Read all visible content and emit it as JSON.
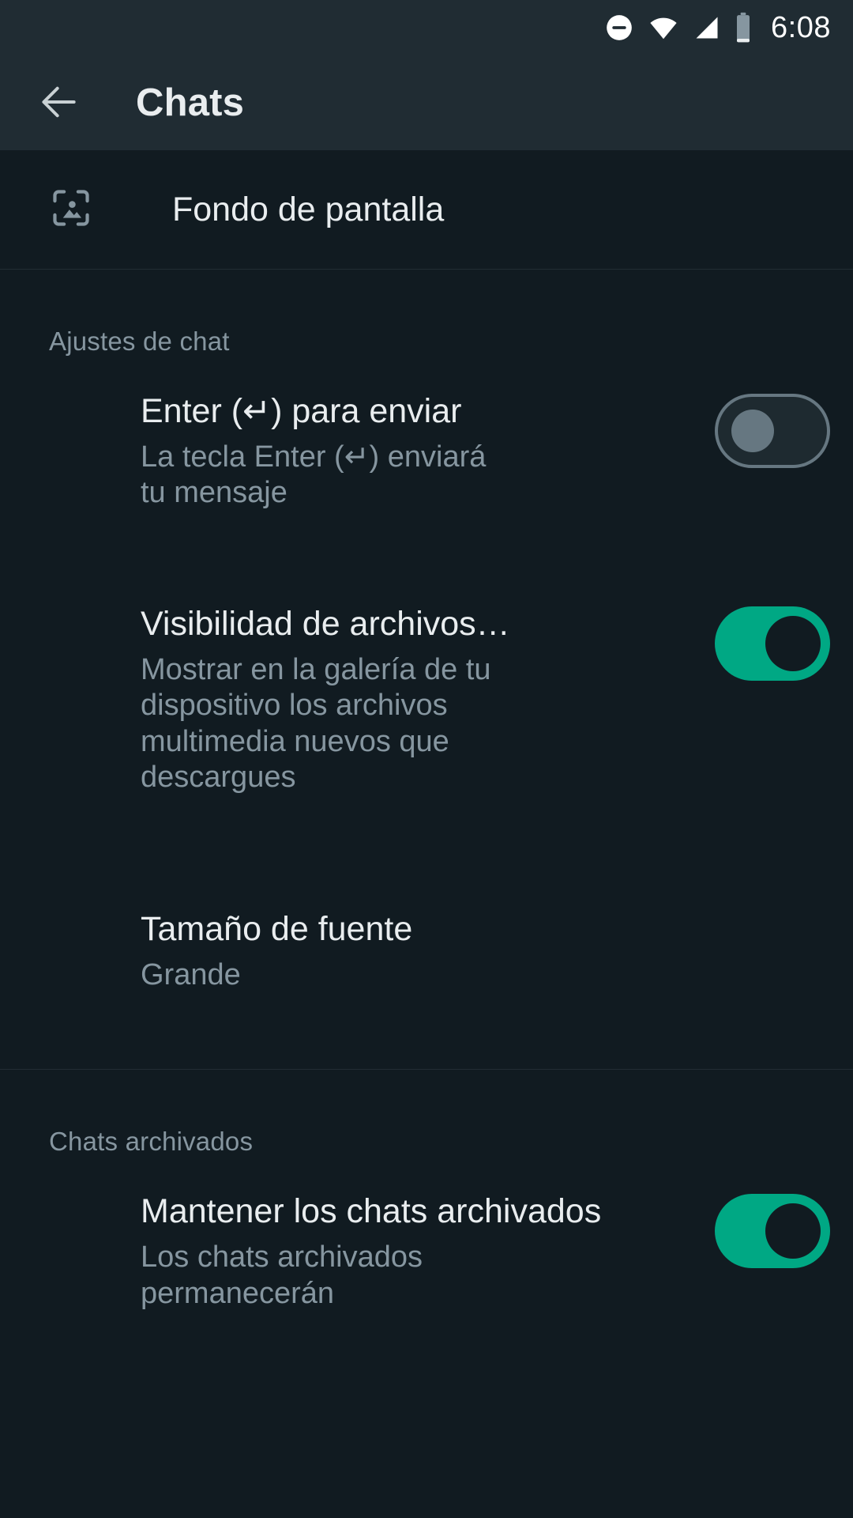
{
  "status_bar": {
    "icons": [
      "do-not-disturb-icon",
      "wifi-icon",
      "cellular-signal-icon",
      "battery-icon"
    ],
    "time": "6:08"
  },
  "app_bar": {
    "back_icon": "back-arrow-icon",
    "title": "Chats"
  },
  "wallpaper": {
    "icon": "wallpaper-image-icon",
    "label": "Fondo de pantalla"
  },
  "sections": [
    {
      "header": "Ajustes de chat",
      "items": [
        {
          "title": "Enter (↵) para enviar",
          "subtitle": "La tecla Enter (↵) enviará tu mensaje",
          "toggle": "off"
        },
        {
          "title": "Visibilidad de archivos…",
          "subtitle": "Mostrar en la galería de tu dispositivo los archivos multimedia nuevos que descargues",
          "toggle": "on"
        },
        {
          "title": "Tamaño de fuente",
          "subtitle": "Grande",
          "toggle": "none"
        }
      ]
    },
    {
      "header": "Chats archivados",
      "items": [
        {
          "title": "Mantener los chats archivados",
          "subtitle": "Los chats archivados permanecerán",
          "toggle": "on"
        }
      ]
    }
  ],
  "colors": {
    "accent": "#00a884",
    "bar_background": "#202c33",
    "page_background": "#111b21",
    "primary_text": "#e9edef",
    "secondary_text": "#8696a0"
  }
}
